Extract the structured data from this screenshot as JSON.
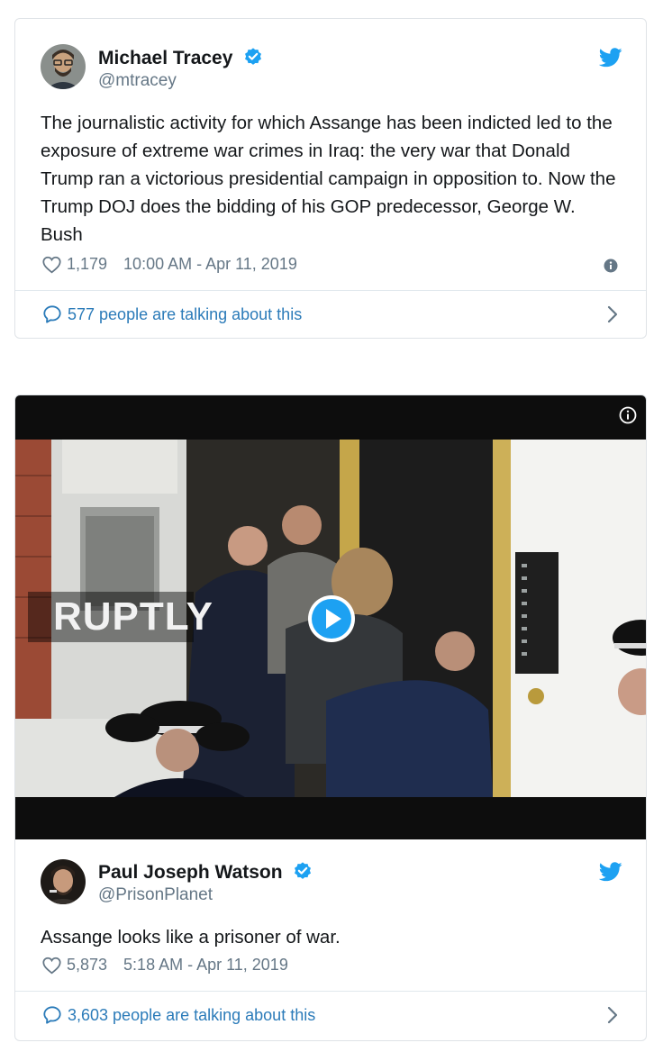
{
  "tweets": [
    {
      "name": "Michael Tracey",
      "handle": "@mtracey",
      "text": "The journalistic activity for which Assange has been indicted led to the exposure of extreme war crimes in Iraq: the very war that Donald Trump ran a victorious presidential campaign in opposition to. Now the Trump DOJ does the bidding of his GOP predecessor, George W. Bush",
      "likes": "1,179",
      "timestamp": "10:00 AM - Apr 11, 2019",
      "talking": "577 people are talking about this"
    },
    {
      "name": "Paul Joseph Watson",
      "handle": "@PrisonPlanet",
      "text": "Assange looks like a prisoner of war.",
      "likes": "5,873",
      "timestamp": "5:18 AM - Apr 11, 2019",
      "talking": "3,603 people are talking about this",
      "video": {
        "watermark": "RUPTLY"
      }
    }
  ],
  "icons": {
    "verified": "verified-badge-icon",
    "bird": "twitter-bird-icon",
    "heart": "heart-icon",
    "info": "info-icon",
    "reply": "reply-bubble-icon",
    "chevron": "chevron-right-icon",
    "play": "play-icon"
  },
  "colors": {
    "twitter_blue": "#1da1f2",
    "link_blue": "#2b7bb9",
    "secondary_text": "#657786",
    "border": "#dfe3e7"
  }
}
